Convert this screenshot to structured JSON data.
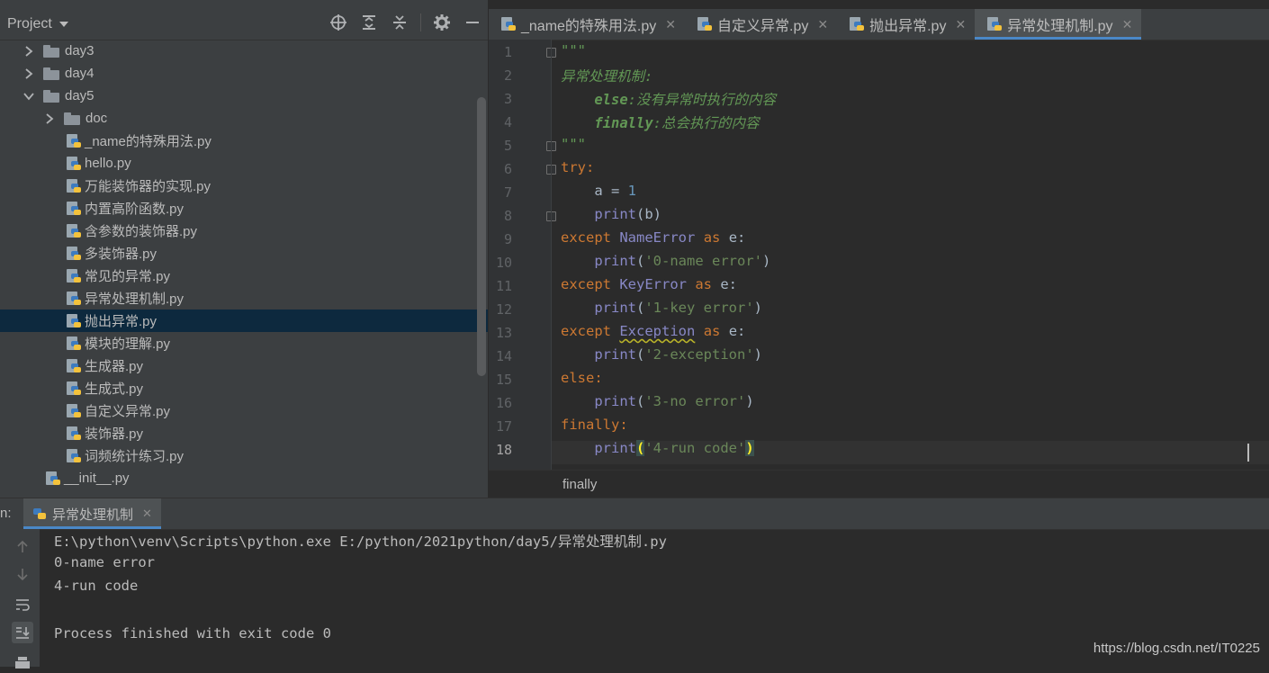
{
  "project_panel": {
    "title": "Project",
    "tree": [
      {
        "label": "day3",
        "type": "folder",
        "expanded": false
      },
      {
        "label": "day4",
        "type": "folder",
        "expanded": false
      },
      {
        "label": "day5",
        "type": "folder",
        "expanded": true
      },
      {
        "label": "doc",
        "type": "folder",
        "expanded": false
      },
      {
        "label": "_name的特殊用法.py",
        "type": "py"
      },
      {
        "label": "hello.py",
        "type": "py"
      },
      {
        "label": "万能装饰器的实现.py",
        "type": "py"
      },
      {
        "label": "内置高阶函数.py",
        "type": "py"
      },
      {
        "label": "含参数的装饰器.py",
        "type": "py"
      },
      {
        "label": "多装饰器.py",
        "type": "py"
      },
      {
        "label": "常见的异常.py",
        "type": "py"
      },
      {
        "label": "异常处理机制.py",
        "type": "py"
      },
      {
        "label": "抛出异常.py",
        "type": "py",
        "selected": true
      },
      {
        "label": "模块的理解.py",
        "type": "py"
      },
      {
        "label": "生成器.py",
        "type": "py"
      },
      {
        "label": "生成式.py",
        "type": "py"
      },
      {
        "label": "自定义异常.py",
        "type": "py"
      },
      {
        "label": "装饰器.py",
        "type": "py"
      },
      {
        "label": "词频统计练习.py",
        "type": "py"
      },
      {
        "label": "__init__.py",
        "type": "py"
      }
    ]
  },
  "editor": {
    "tabs": [
      {
        "label": "_name的特殊用法.py",
        "active": false
      },
      {
        "label": "自定义异常.py",
        "active": false
      },
      {
        "label": "抛出异常.py",
        "active": false
      },
      {
        "label": "异常处理机制.py",
        "active": true
      }
    ],
    "line_numbers": [
      "1",
      "2",
      "3",
      "4",
      "5",
      "6",
      "7",
      "8",
      "9",
      "10",
      "11",
      "12",
      "13",
      "14",
      "15",
      "16",
      "17",
      "18"
    ],
    "current_line": "18",
    "code": {
      "l1": "\"\"\"",
      "l2": "异常处理机制:",
      "l3_kw": "    else",
      "l3_rest": ":没有异常时执行的内容",
      "l4_kw": "    finally",
      "l4_rest": ":总会执行的内容",
      "l5": "\"\"\"",
      "l6_kw": "try",
      "l6_p": ":",
      "l7_a": "    a = ",
      "l7_n": "1",
      "l8_f": "    print",
      "l8_r": "(b)",
      "except": "except",
      "as": "as",
      "l9_cls": "NameError",
      "l10_str": "'0-name error'",
      "l11_cls": "KeyError",
      "l12_str": "'1-key error'",
      "l13_cls": "Exception",
      "l14_str": "'2-exception'",
      "l15_kw": "else",
      "l16_str": "'3-no error'",
      "l17_kw": "finally",
      "l18_str": "'4-run code'",
      "print": "    print",
      "e_colon": " e:",
      "paren_open": "(",
      "paren_close": ")",
      "colon": ":"
    },
    "breadcrumb": "finally"
  },
  "run_panel": {
    "prefix": "n:",
    "tab_label": "异常处理机制",
    "output": [
      "E:\\python\\venv\\Scripts\\python.exe E:/python/2021python/day5/异常处理机制.py",
      "0-name error",
      "4-run code",
      "",
      "Process finished with exit code 0"
    ]
  },
  "watermark": "https://blog.csdn.net/IT0225",
  "colors": {
    "keyword": "#cc7832",
    "docstring": "#629755",
    "string": "#6a8759",
    "number": "#6897bb",
    "builtin": "#8888c6",
    "selection": "#0d293e",
    "accent": "#4a88c7"
  }
}
